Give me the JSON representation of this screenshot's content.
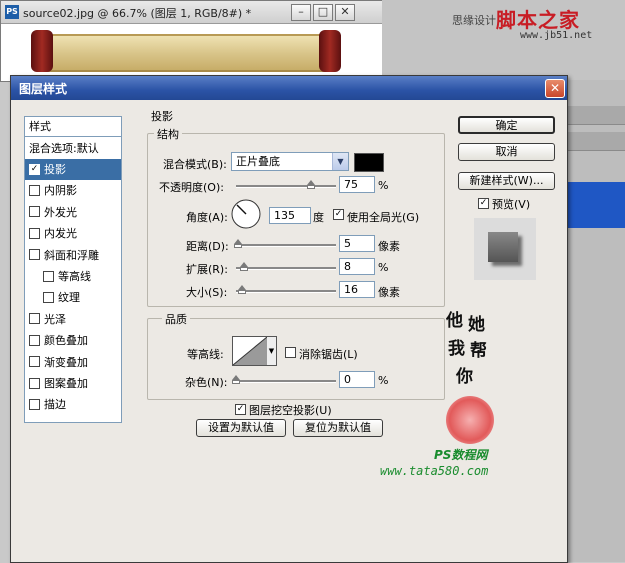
{
  "document_window": {
    "title": "source02.jpg @ 66.7% (图层 1, RGB/8#) *",
    "app_icon": "PS",
    "controls": [
      "minimize-icon",
      "restore-icon",
      "close-icon"
    ]
  },
  "top_watermark": {
    "small_text": "思缘设计",
    "brand": "脚本之家",
    "url": "www.jb51.net"
  },
  "dialog": {
    "title": "图层样式",
    "close_icon": "close-icon"
  },
  "styles_list": {
    "header": "样式",
    "blending_options": "混合选项:默认",
    "items": [
      {
        "label": "投影",
        "checked": true,
        "selected": true,
        "sub": false
      },
      {
        "label": "内阴影",
        "checked": false,
        "selected": false,
        "sub": false
      },
      {
        "label": "外发光",
        "checked": false,
        "selected": false,
        "sub": false
      },
      {
        "label": "内发光",
        "checked": false,
        "selected": false,
        "sub": false
      },
      {
        "label": "斜面和浮雕",
        "checked": false,
        "selected": false,
        "sub": false
      },
      {
        "label": "等高线",
        "checked": false,
        "selected": false,
        "sub": true
      },
      {
        "label": "纹理",
        "checked": false,
        "selected": false,
        "sub": true
      },
      {
        "label": "光泽",
        "checked": false,
        "selected": false,
        "sub": false
      },
      {
        "label": "颜色叠加",
        "checked": false,
        "selected": false,
        "sub": false
      },
      {
        "label": "渐变叠加",
        "checked": false,
        "selected": false,
        "sub": false
      },
      {
        "label": "图案叠加",
        "checked": false,
        "selected": false,
        "sub": false
      },
      {
        "label": "描边",
        "checked": false,
        "selected": false,
        "sub": false
      }
    ]
  },
  "drop_shadow": {
    "section_title": "投影",
    "structure": {
      "title": "结构",
      "blend_mode_label": "混合模式(B):",
      "blend_mode_value": "正片叠底",
      "shadow_color": "#000000",
      "opacity_label": "不透明度(O):",
      "opacity_value": "75",
      "opacity_unit": "%",
      "opacity_fraction": 0.75,
      "angle_label": "角度(A):",
      "angle_value": "135",
      "angle_unit": "度",
      "global_light_label": "使用全局光(G)",
      "global_light_checked": true,
      "distance_label": "距离(D):",
      "distance_value": "5",
      "distance_unit": "像素",
      "distance_fraction": 0.02,
      "spread_label": "扩展(R):",
      "spread_value": "8",
      "spread_unit": "%",
      "spread_fraction": 0.08,
      "size_label": "大小(S):",
      "size_value": "16",
      "size_unit": "像素",
      "size_fraction": 0.06
    },
    "quality": {
      "title": "品质",
      "contour_label": "等高线:",
      "anti_alias_label": "消除锯齿(L)",
      "anti_alias_checked": false,
      "noise_label": "杂色(N):",
      "noise_value": "0",
      "noise_unit": "%",
      "noise_fraction": 0.0
    },
    "knockout_label": "图层挖空投影(U)",
    "knockout_checked": true,
    "make_default_label": "设置为默认值",
    "reset_default_label": "复位为默认值"
  },
  "buttons": {
    "ok": "确定",
    "cancel": "取消",
    "new_style": "新建样式(W)...",
    "preview_label": "预览(V)",
    "preview_checked": true
  },
  "side_watermark": {
    "vertical_chars": [
      "他",
      "她",
      "我",
      "帮",
      "你"
    ],
    "ps_label": "PS数程网",
    "url": "www.tata580.com"
  }
}
